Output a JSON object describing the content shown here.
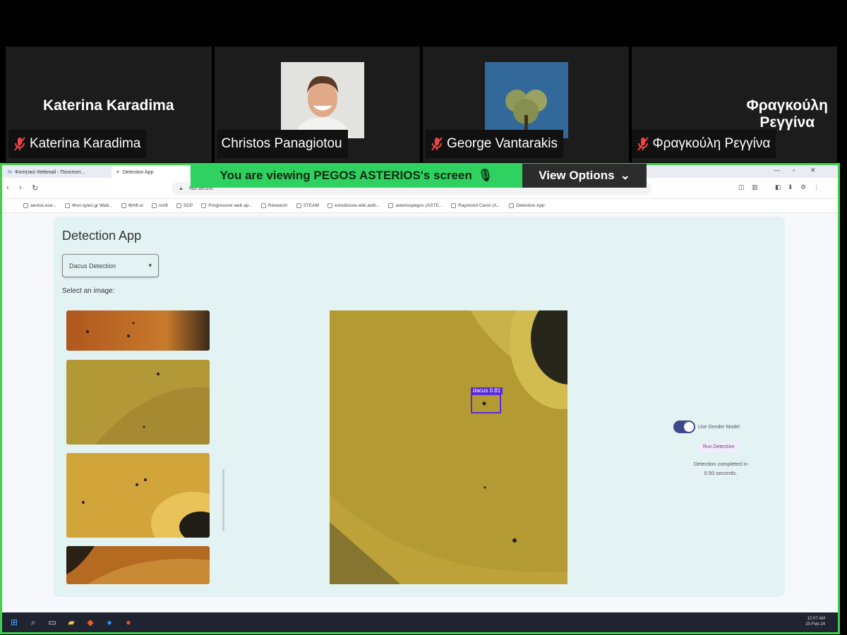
{
  "participants": [
    {
      "big_name": "Katerina Karadima",
      "tag": "Katerina Karadima",
      "muted": true,
      "has_photo": false
    },
    {
      "big_name": "",
      "tag": "Christos Panagiotou",
      "muted": false,
      "has_photo": true
    },
    {
      "big_name": "",
      "tag": "George Vantarakis",
      "muted": true,
      "has_photo": true
    },
    {
      "big_name": "Φραγκούλη Ρεγγίνα",
      "tag": "Φραγκούλη Ρεγγίνα",
      "muted": true,
      "has_photo": false
    }
  ],
  "share_banner": {
    "text": "You are viewing  PEGOS ASTERIOS's screen",
    "view_options": "View Options"
  },
  "browser": {
    "tabs": [
      "Φοιτητικό Webmail - Πανεπιστ...",
      "Detection App"
    ],
    "url_security": "Not secure",
    "bookmarks": [
      "aeolos.ece...",
      "Φοιτ.ηγικό.gr Web...",
      "ΦΑΦ.ui",
      "rooft",
      "SCP",
      "Progressive web ap...",
      "Research",
      "STEAM",
      "estudioone.wiki.auth...",
      "asteriospegos (ASTE...",
      "Raymond Cenci (A...",
      "Detection App"
    ]
  },
  "app": {
    "title": "Detection App",
    "model_select": {
      "value": "Dacus Detection"
    },
    "select_label": "Select an image:",
    "detection": {
      "label": "dacus",
      "score": "0.81"
    },
    "toggle_label": "Use Gender Model",
    "run_button": "Run Detection",
    "status": "Detection completed in 0.50 seconds."
  },
  "taskbar": {
    "clock_time": "12:07 AM",
    "clock_date": "20-Feb-24"
  },
  "colors": {
    "share_border": "#3fcf4a",
    "banner_green": "#2fd160",
    "card_bg": "#e3f2f3",
    "bbox": "#5a2bd8",
    "toggle_on": "#3d4a8a"
  }
}
